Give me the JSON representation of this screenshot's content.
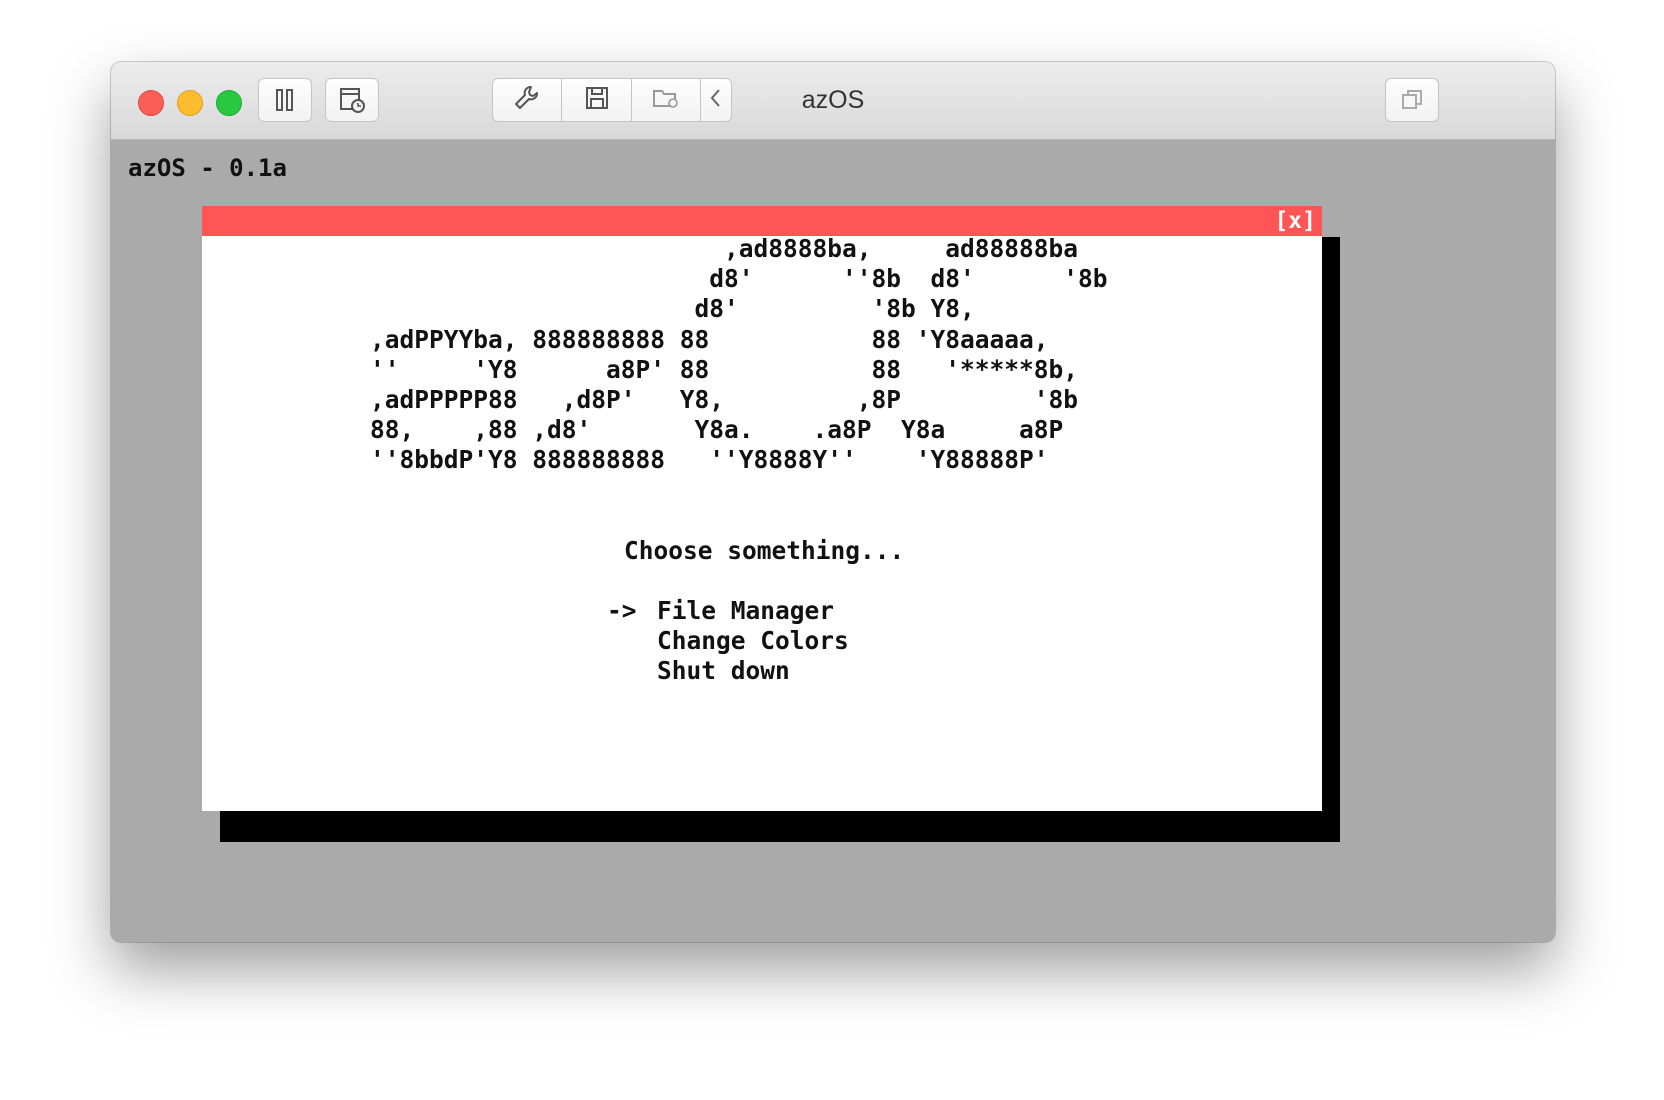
{
  "window": {
    "title": "azOS",
    "toolbar_icons": [
      "pause-icon",
      "snapshot-icon",
      "wrench-icon",
      "floppy-disk-icon",
      "shared-folder-icon",
      "chevron-left-icon",
      "duplicate-window-icon"
    ]
  },
  "screen": {
    "os_label": "azOS - 0.1a",
    "background_color": "#aaaaaa",
    "dialog": {
      "close_label": "[x]",
      "bar_color": "#ff5555",
      "logo": [
        "                        ,ad8888ba,     ad88888ba",
        "                       d8'      ''8b  d8'      '8b",
        "                      d8'         '8b Y8,",
        ",adPPYYba, 888888888 88           88 'Y8aaaaa,",
        "''     'Y8      a8P' 88           88   '*****8b,",
        ",adPPPPP88   ,d8P'   Y8,         ,8P         '8b",
        "88,    ,88 ,d8'       Y8a.    .a8P  Y8a     a8P",
        "''8bbdP'Y8 888888888   ''Y8888Y''    'Y88888P'"
      ],
      "prompt": "Choose something...",
      "menu": {
        "cursor": "->",
        "items": [
          "File Manager",
          "Change Colors",
          "Shut down"
        ]
      }
    }
  }
}
